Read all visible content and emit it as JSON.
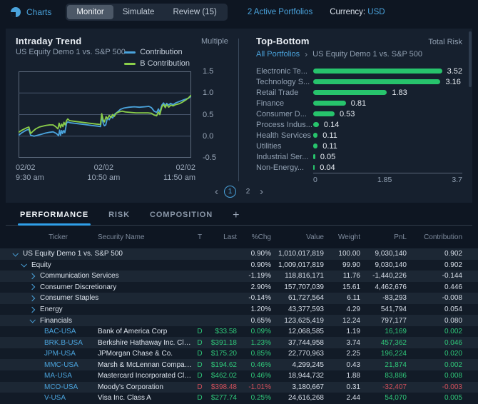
{
  "topbar": {
    "app_label": "Charts",
    "modes": [
      "Monitor",
      "Simulate",
      "Review (15)"
    ],
    "active_mode": "Monitor",
    "portfolios_link": "2 Active Portfolios",
    "currency_label": "Currency:",
    "currency_value": "USD"
  },
  "intraday": {
    "title": "Intraday Trend",
    "subtitle": "US Equity Demo 1 vs. S&P 500",
    "y_axis_label": "Multiple"
  },
  "topbottom": {
    "title": "Top-Bottom",
    "risk_label": "Total Risk",
    "breadcrumb_root": "All Portfolios",
    "breadcrumb_sep": "›",
    "breadcrumb_current": "US Equity Demo 1 vs. S&P 500"
  },
  "pagination": {
    "prev": "‹",
    "pages": [
      "1",
      "2"
    ],
    "active": "1",
    "next": "›"
  },
  "tabs": {
    "items": [
      "PERFORMANCE",
      "RISK",
      "COMPOSITION"
    ],
    "active": "PERFORMANCE",
    "add_label": "+"
  },
  "colors": {
    "accent_blue": "#4aa3dc",
    "bar_green": "#27c36c",
    "positive": "#2fc779",
    "negative": "#d24f5a"
  },
  "chart_data": [
    {
      "type": "line",
      "title": "Intraday Trend",
      "subtitle": "US Equity Demo 1 vs. S&P 500",
      "ylabel": "Multiple",
      "ylim": [
        -0.5,
        1.5
      ],
      "y_ticks": [
        "1.5",
        "1.0",
        "0.5",
        "0.0",
        "-0.5"
      ],
      "x_ticks": [
        {
          "date": "02/02",
          "time": "9:30 am"
        },
        {
          "date": "02/02",
          "time": "10:50 am"
        },
        {
          "date": "02/02",
          "time": "11:50 am"
        }
      ],
      "grid": true,
      "legend_position": "top-right",
      "series": [
        {
          "name": "Contribution",
          "color": "#4aa3dc",
          "points": [
            [
              0,
              0.02
            ],
            [
              0.02,
              0.08
            ],
            [
              0.045,
              0.14
            ],
            [
              0.06,
              0.16
            ],
            [
              0.07,
              0.02
            ],
            [
              0.09,
              0
            ],
            [
              0.11,
              0.02
            ],
            [
              0.13,
              0.04
            ],
            [
              0.155,
              0.07
            ],
            [
              0.18,
              0.09
            ],
            [
              0.2,
              0.1
            ],
            [
              0.22,
              0.06
            ],
            [
              0.232,
              0.01
            ],
            [
              0.238,
              0.14
            ],
            [
              0.243,
              0.02
            ],
            [
              0.25,
              0.13
            ],
            [
              0.255,
              0.06
            ],
            [
              0.262,
              0.13
            ],
            [
              0.268,
              0.08
            ],
            [
              0.278,
              0.3
            ],
            [
              0.285,
              0.33
            ],
            [
              0.3,
              0.31
            ],
            [
              0.34,
              0.29
            ],
            [
              0.38,
              0.27
            ],
            [
              0.42,
              0.25
            ],
            [
              0.46,
              0.23
            ],
            [
              0.475,
              0.22
            ],
            [
              0.482,
              0.47
            ],
            [
              0.49,
              0.3
            ],
            [
              0.497,
              0.24
            ],
            [
              0.505,
              0.26
            ],
            [
              0.515,
              0.42
            ],
            [
              0.525,
              0.38
            ],
            [
              0.535,
              0.46
            ],
            [
              0.545,
              0.42
            ],
            [
              0.555,
              0.5
            ],
            [
              0.57,
              0.55
            ],
            [
              0.59,
              0.62
            ],
            [
              0.61,
              0.65
            ],
            [
              0.64,
              0.67
            ],
            [
              0.67,
              0.68
            ],
            [
              0.7,
              0.67
            ],
            [
              0.73,
              0.68
            ],
            [
              0.755,
              0.69
            ],
            [
              0.77,
              0.66
            ],
            [
              0.785,
              0.58
            ],
            [
              0.8,
              0.55
            ],
            [
              0.81,
              0.63
            ],
            [
              0.818,
              0.56
            ],
            [
              0.83,
              0.72
            ],
            [
              0.84,
              0.77
            ],
            [
              0.85,
              0.7
            ],
            [
              0.858,
              0.76
            ],
            [
              0.87,
              0.72
            ],
            [
              0.88,
              0.76
            ],
            [
              0.895,
              0.73
            ],
            [
              0.91,
              0.77
            ],
            [
              0.93,
              0.8
            ],
            [
              0.95,
              0.83
            ],
            [
              0.97,
              0.86
            ],
            [
              0.985,
              0.88
            ],
            [
              1,
              0.93
            ]
          ]
        },
        {
          "name": "B Contribution",
          "color": "#8bcf4a",
          "points": [
            [
              0,
              0.09
            ],
            [
              0.02,
              0.14
            ],
            [
              0.045,
              0.19
            ],
            [
              0.06,
              0.21
            ],
            [
              0.07,
              0.06
            ],
            [
              0.085,
              0.12
            ],
            [
              0.1,
              0.17
            ],
            [
              0.12,
              0.21
            ],
            [
              0.14,
              0.23
            ],
            [
              0.16,
              0.25
            ],
            [
              0.18,
              0.26
            ],
            [
              0.2,
              0.26
            ],
            [
              0.215,
              0.22
            ],
            [
              0.228,
              0.17
            ],
            [
              0.235,
              0.3
            ],
            [
              0.243,
              0.2
            ],
            [
              0.25,
              0.28
            ],
            [
              0.257,
              0.22
            ],
            [
              0.263,
              0.32
            ],
            [
              0.27,
              0.26
            ],
            [
              0.278,
              0.36
            ],
            [
              0.285,
              0.4
            ],
            [
              0.295,
              0.36
            ],
            [
              0.33,
              0.34
            ],
            [
              0.37,
              0.32
            ],
            [
              0.41,
              0.3
            ],
            [
              0.45,
              0.28
            ],
            [
              0.475,
              0.27
            ],
            [
              0.482,
              0.52
            ],
            [
              0.49,
              0.38
            ],
            [
              0.497,
              0.33
            ],
            [
              0.507,
              0.45
            ],
            [
              0.515,
              0.4
            ],
            [
              0.525,
              0.48
            ],
            [
              0.535,
              0.43
            ],
            [
              0.545,
              0.5
            ],
            [
              0.555,
              0.46
            ],
            [
              0.565,
              0.53
            ],
            [
              0.58,
              0.56
            ],
            [
              0.6,
              0.58
            ],
            [
              0.62,
              0.56
            ],
            [
              0.65,
              0.55
            ],
            [
              0.68,
              0.54
            ],
            [
              0.72,
              0.54
            ],
            [
              0.75,
              0.54
            ],
            [
              0.77,
              0.53
            ],
            [
              0.785,
              0.49
            ],
            [
              0.8,
              0.47
            ],
            [
              0.81,
              0.56
            ],
            [
              0.818,
              0.5
            ],
            [
              0.83,
              0.68
            ],
            [
              0.84,
              0.73
            ],
            [
              0.85,
              0.66
            ],
            [
              0.858,
              0.73
            ],
            [
              0.87,
              0.67
            ],
            [
              0.882,
              0.72
            ],
            [
              0.895,
              0.7
            ],
            [
              0.91,
              0.73
            ],
            [
              0.93,
              0.75
            ],
            [
              0.95,
              0.79
            ],
            [
              0.97,
              0.84
            ],
            [
              0.985,
              0.89
            ],
            [
              1,
              0.95
            ]
          ]
        }
      ]
    },
    {
      "type": "bar",
      "title": "Top-Bottom",
      "value_label": "Total Risk",
      "orientation": "horizontal",
      "categories": [
        "Electronic Te...",
        "Technology S...",
        "Retail Trade",
        "Finance",
        "Consumer D...",
        "Process Indus...",
        "Health Services",
        "Utilities",
        "Industrial Ser...",
        "Non-Energy..."
      ],
      "values": [
        3.52,
        3.16,
        1.83,
        0.81,
        0.53,
        0.14,
        0.11,
        0.11,
        0.05,
        0.04
      ],
      "xlim": [
        0,
        3.7
      ],
      "x_ticks": [
        "0",
        "1.85",
        "3.7"
      ],
      "bar_color": "#27c36c"
    }
  ],
  "table": {
    "columns": [
      "Ticker",
      "Security Name",
      "T",
      "Last",
      "%Chg",
      "Value",
      "Weight",
      "PnL",
      "Contribution"
    ],
    "rows": [
      {
        "type": "group",
        "level": 0,
        "expanded": true,
        "name": "US Equity Demo 1 vs. S&P 500",
        "chg": "0.90%",
        "value": "1,010,017,819",
        "weight": "100.00",
        "pnl": "9,030,140",
        "contribution": "0.902"
      },
      {
        "type": "group",
        "level": 1,
        "expanded": true,
        "name": "Equity",
        "chg": "0.90%",
        "value": "1,009,017,819",
        "weight": "99.90",
        "pnl": "9,030,140",
        "contribution": "0.902"
      },
      {
        "type": "group",
        "level": 2,
        "expanded": false,
        "name": "Communication Services",
        "chg": "-1.19%",
        "value": "118,816,171",
        "weight": "11.76",
        "pnl": "-1,440,226",
        "contribution": "-0.144"
      },
      {
        "type": "group",
        "level": 2,
        "expanded": false,
        "name": "Consumer Discretionary",
        "chg": "2.90%",
        "value": "157,707,039",
        "weight": "15.61",
        "pnl": "4,462,676",
        "contribution": "0.446"
      },
      {
        "type": "group",
        "level": 2,
        "expanded": false,
        "name": "Consumer Staples",
        "chg": "-0.14%",
        "value": "61,727,564",
        "weight": "6.11",
        "pnl": "-83,293",
        "contribution": "-0.008"
      },
      {
        "type": "group",
        "level": 2,
        "expanded": false,
        "name": "Energy",
        "chg": "1.20%",
        "value": "43,377,593",
        "weight": "4.29",
        "pnl": "541,794",
        "contribution": "0.054"
      },
      {
        "type": "group",
        "level": 2,
        "expanded": true,
        "name": "Financials",
        "chg": "0.65%",
        "value": "123,625,419",
        "weight": "12.24",
        "pnl": "797,177",
        "contribution": "0.080"
      },
      {
        "type": "stock",
        "ticker": "BAC-USA",
        "name": "Bank of America Corp",
        "t": "D",
        "last": "$33.58",
        "chg": "0.09%",
        "value": "12,068,585",
        "weight": "1.19",
        "pnl": "16,169",
        "contribution": "0.002",
        "trend": "up"
      },
      {
        "type": "stock",
        "ticker": "BRK.B-USA",
        "name": "Berkshire Hathaway Inc. Clas...",
        "t": "D",
        "last": "$391.18",
        "chg": "1.23%",
        "value": "37,744,958",
        "weight": "3.74",
        "pnl": "457,362",
        "contribution": "0.046",
        "trend": "up"
      },
      {
        "type": "stock",
        "ticker": "JPM-USA",
        "name": "JPMorgan Chase & Co.",
        "t": "D",
        "last": "$175.20",
        "chg": "0.85%",
        "value": "22,770,963",
        "weight": "2.25",
        "pnl": "196,224",
        "contribution": "0.020",
        "trend": "up"
      },
      {
        "type": "stock",
        "ticker": "MMC-USA",
        "name": "Marsh & McLennan Companie...",
        "t": "D",
        "last": "$194.62",
        "chg": "0.46%",
        "value": "4,299,245",
        "weight": "0.43",
        "pnl": "21,874",
        "contribution": "0.002",
        "trend": "up"
      },
      {
        "type": "stock",
        "ticker": "MA-USA",
        "name": "Mastercard Incorporated Clas...",
        "t": "D",
        "last": "$462.02",
        "chg": "0.46%",
        "value": "18,944,732",
        "weight": "1.88",
        "pnl": "83,886",
        "contribution": "0.008",
        "trend": "up"
      },
      {
        "type": "stock",
        "ticker": "MCO-USA",
        "name": "Moody's Corporation",
        "t": "D",
        "last": "$398.48",
        "chg": "-1.01%",
        "value": "3,180,667",
        "weight": "0.31",
        "pnl": "-32,407",
        "contribution": "-0.003",
        "trend": "down"
      },
      {
        "type": "stock",
        "ticker": "V-USA",
        "name": "Visa Inc. Class A",
        "t": "D",
        "last": "$277.74",
        "chg": "0.25%",
        "value": "24,616,268",
        "weight": "2.44",
        "pnl": "54,070",
        "contribution": "0.005",
        "trend": "up"
      }
    ]
  }
}
